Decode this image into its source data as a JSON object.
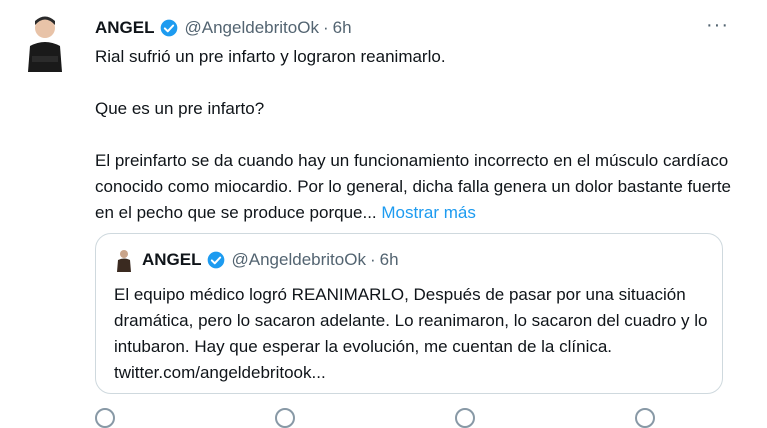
{
  "tweet": {
    "name": "ANGEL",
    "handle": "@AngeldebritoOk",
    "separator": "·",
    "time": "6h",
    "more_icon": "more-icon",
    "paragraphs": [
      "Rial sufrió un pre infarto y lograron  reanimarlo.",
      "Que es un pre infarto?",
      "El preinfarto se da cuando hay un funcionamiento incorrecto en el músculo cardíaco conocido como miocardio. Por lo general, dicha falla genera un dolor bastante fuerte en el pecho que se produce porque..."
    ],
    "show_more": "Mostrar más"
  },
  "quote": {
    "name": "ANGEL",
    "handle": "@AngeldebritoOk",
    "separator": "·",
    "time": "6h",
    "text": "El equipo médico logró REANIMARLO, Después de pasar por una situación dramática, pero lo sacaron adelante. Lo reanimaron, lo sacaron del cuadro y lo intubaron. Hay que esperar la evolución, me cuentan de la clínica. twitter.com/angeldebritook..."
  },
  "colors": {
    "accent": "#1d9bf0",
    "secondary": "#536471",
    "border": "#cfd9de"
  }
}
